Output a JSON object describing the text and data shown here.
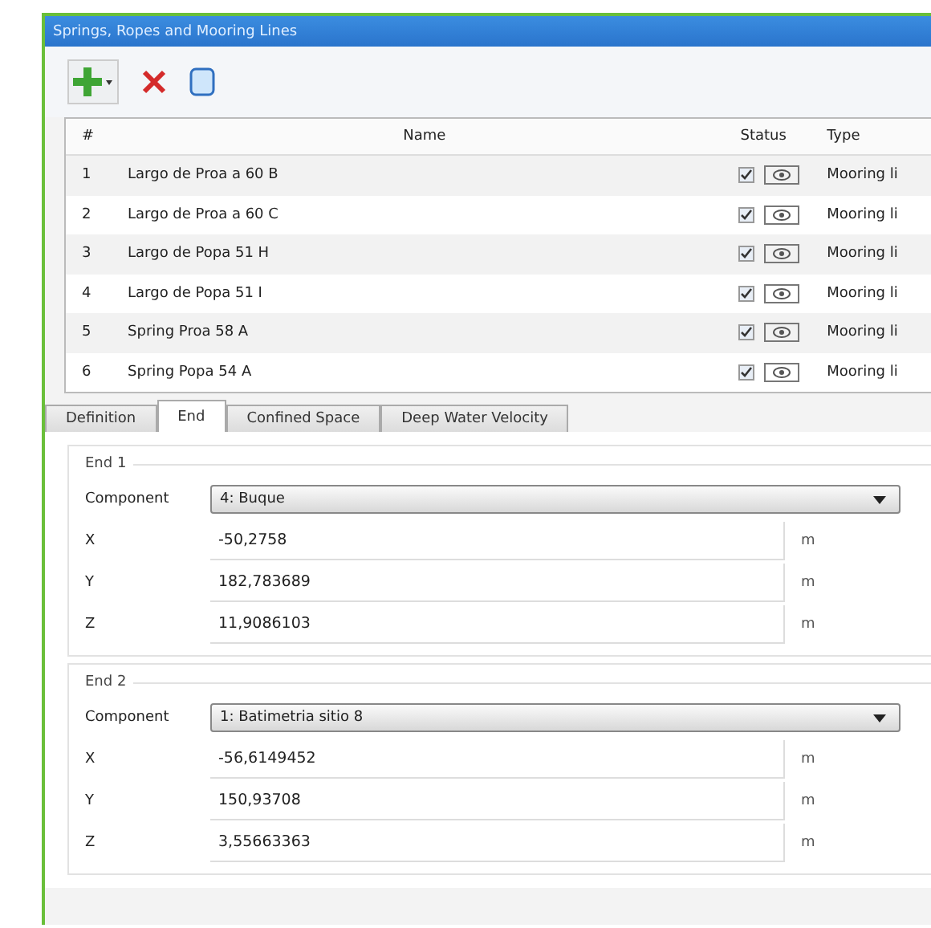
{
  "window": {
    "title": "Springs, Ropes and Mooring Lines"
  },
  "table": {
    "columns": [
      "#",
      "Name",
      "Status",
      "Type"
    ],
    "rows": [
      {
        "number": "1",
        "name": "Largo de Proa a 60 B",
        "checked": true,
        "type": "Mooring li"
      },
      {
        "number": "2",
        "name": "Largo de Proa a 60 C",
        "checked": true,
        "type": "Mooring li"
      },
      {
        "number": "3",
        "name": "Largo de Popa 51 H",
        "checked": true,
        "type": "Mooring li"
      },
      {
        "number": "4",
        "name": "Largo de Popa 51 I",
        "checked": true,
        "type": "Mooring li"
      },
      {
        "number": "5",
        "name": "Spring Proa 58 A",
        "checked": true,
        "type": "Mooring li"
      },
      {
        "number": "6",
        "name": "Spring Popa 54 A",
        "checked": true,
        "type": "Mooring li"
      }
    ]
  },
  "tabs": [
    {
      "label": "Definition",
      "selected": false
    },
    {
      "label": "End",
      "selected": true
    },
    {
      "label": "Confined Space",
      "selected": false
    },
    {
      "label": "Deep Water Velocity",
      "selected": false
    }
  ],
  "groups": [
    {
      "title": "End 1",
      "component_label": "Component",
      "component": "4: Buque",
      "fields": [
        {
          "label": "X",
          "value": "-50,2758",
          "unit": "m"
        },
        {
          "label": "Y",
          "value": "182,783689",
          "unit": "m"
        },
        {
          "label": "Z",
          "value": "11,9086103",
          "unit": "m"
        }
      ]
    },
    {
      "title": "End 2",
      "component_label": "Component",
      "component": "1: Batimetria sitio 8",
      "fields": [
        {
          "label": "X",
          "value": "-56,6149452",
          "unit": "m"
        },
        {
          "label": "Y",
          "value": "150,93708",
          "unit": "m"
        },
        {
          "label": "Z",
          "value": "3,55663363",
          "unit": "m"
        }
      ]
    }
  ]
}
